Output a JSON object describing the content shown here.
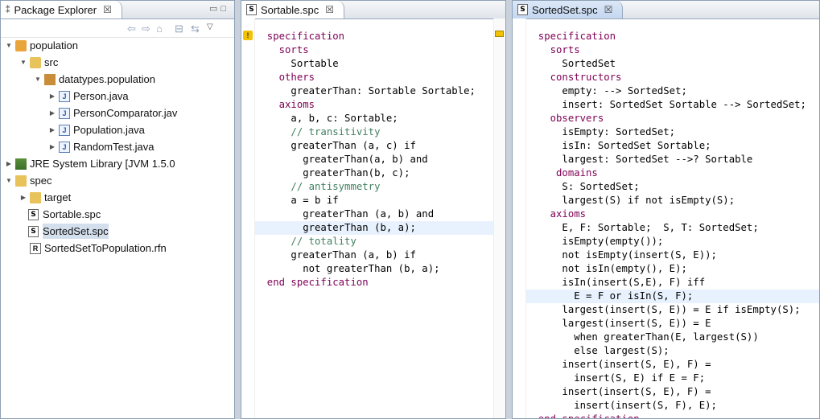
{
  "package_explorer": {
    "title": "Package Explorer",
    "close": "☒",
    "tree": [
      {
        "label": "population",
        "indent": 0,
        "twisty": "▼",
        "icon": "project"
      },
      {
        "label": "src",
        "indent": 1,
        "twisty": "▼",
        "icon": "src"
      },
      {
        "label": "datatypes.population",
        "indent": 2,
        "twisty": "▼",
        "icon": "package"
      },
      {
        "label": "Person.java",
        "indent": 3,
        "twisty": "▶",
        "icon": "java"
      },
      {
        "label": "PersonComparator.jav",
        "indent": 3,
        "twisty": "▶",
        "icon": "java"
      },
      {
        "label": "Population.java",
        "indent": 3,
        "twisty": "▶",
        "icon": "java"
      },
      {
        "label": "RandomTest.java",
        "indent": 3,
        "twisty": "▶",
        "icon": "java"
      },
      {
        "label": "JRE System Library [JVM 1.5.0",
        "indent": 0,
        "twisty": "▶",
        "icon": "library"
      },
      {
        "label": "spec",
        "indent": 0,
        "twisty": "▼",
        "icon": "folder"
      },
      {
        "label": "target",
        "indent": 1,
        "twisty": "▶",
        "icon": "folder"
      },
      {
        "label": "Sortable.spc",
        "indent": 1,
        "twisty": "",
        "icon": "spc"
      },
      {
        "label": "SortedSet.spc",
        "indent": 1,
        "twisty": "",
        "icon": "spc",
        "selected": true
      },
      {
        "label": "SortedSetToPopulation.rfn",
        "indent": 1,
        "twisty": "",
        "icon": "rfn"
      }
    ]
  },
  "editor1": {
    "tab": "Sortable.spc",
    "close": "☒",
    "lines": [
      {
        "t": "specification",
        "c": "kw"
      },
      {
        "t": "  sorts",
        "c": "kw"
      },
      {
        "t": "    Sortable",
        "c": "id"
      },
      {
        "t": "  others",
        "c": "kw"
      },
      {
        "t": "    greaterThan: Sortable Sortable;",
        "c": "id"
      },
      {
        "t": "  axioms",
        "c": "kw"
      },
      {
        "t": "    a, b, c: Sortable;",
        "c": "id"
      },
      {
        "t": "    // transitivity",
        "c": "cm"
      },
      {
        "t": "    greaterThan (a, c) if",
        "c": "id"
      },
      {
        "t": "      greaterThan(a, b) and",
        "c": "id"
      },
      {
        "t": "      greaterThan(b, c);",
        "c": "id"
      },
      {
        "t": "    // antisymmetry",
        "c": "cm"
      },
      {
        "t": "    a = b if",
        "c": "id"
      },
      {
        "t": "      greaterThan (a, b) and",
        "c": "id"
      },
      {
        "t": "      greaterThan (b, a);",
        "c": "id",
        "hl": true
      },
      {
        "t": "    // totality",
        "c": "cm"
      },
      {
        "t": "    greaterThan (a, b) if",
        "c": "id"
      },
      {
        "t": "      not greaterThan (b, a);",
        "c": "id"
      },
      {
        "t": "end specification",
        "c": "kw"
      }
    ]
  },
  "editor2": {
    "tab": "SortedSet.spc",
    "close": "☒",
    "lines": [
      {
        "t": "specification",
        "c": "kw"
      },
      {
        "t": "  sorts",
        "c": "kw"
      },
      {
        "t": "    SortedSet",
        "c": "id"
      },
      {
        "t": "  constructors",
        "c": "kw"
      },
      {
        "t": "    empty: --> SortedSet;",
        "c": "id"
      },
      {
        "t": "    insert: SortedSet Sortable --> SortedSet;",
        "c": "id"
      },
      {
        "t": "  observers",
        "c": "kw"
      },
      {
        "t": "    isEmpty: SortedSet;",
        "c": "id"
      },
      {
        "t": "    isIn: SortedSet Sortable;",
        "c": "id"
      },
      {
        "t": "    largest: SortedSet -->? Sortable",
        "c": "id"
      },
      {
        "t": "   domains",
        "c": "kw"
      },
      {
        "t": "    S: SortedSet;",
        "c": "id"
      },
      {
        "t": "    largest(S) if not isEmpty(S);",
        "c": "id"
      },
      {
        "t": "  axioms",
        "c": "kw"
      },
      {
        "t": "    E, F: Sortable;  S, T: SortedSet;",
        "c": "id"
      },
      {
        "t": "    isEmpty(empty());",
        "c": "id"
      },
      {
        "t": "    not isEmpty(insert(S, E));",
        "c": "id"
      },
      {
        "t": "    not isIn(empty(), E);",
        "c": "id"
      },
      {
        "t": "    isIn(insert(S,E), F) iff",
        "c": "id"
      },
      {
        "t": "      E = F or isIn(S, F);",
        "c": "id",
        "hl": true
      },
      {
        "t": "    largest(insert(S, E)) = E if isEmpty(S);",
        "c": "id"
      },
      {
        "t": "    largest(insert(S, E)) = E",
        "c": "id"
      },
      {
        "t": "      when greaterThan(E, largest(S))",
        "c": "id"
      },
      {
        "t": "      else largest(S);",
        "c": "id"
      },
      {
        "t": "    insert(insert(S, E), F) =",
        "c": "id"
      },
      {
        "t": "      insert(S, E) if E = F;",
        "c": "id"
      },
      {
        "t": "    insert(insert(S, E), F) =",
        "c": "id"
      },
      {
        "t": "      insert(insert(S, F), E);",
        "c": "id"
      },
      {
        "t": "end specification",
        "c": "kw"
      }
    ]
  }
}
